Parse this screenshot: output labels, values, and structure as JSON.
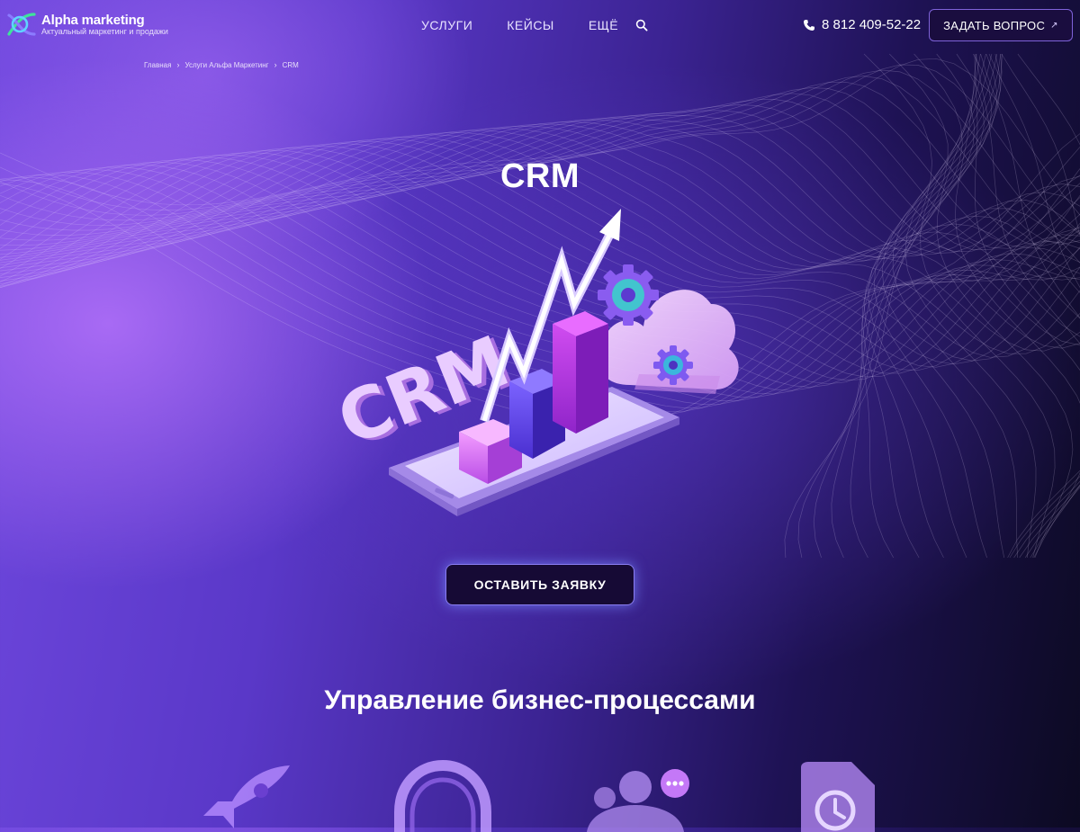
{
  "header": {
    "logo": {
      "name": "Alpha marketing",
      "tagline": "Актуальный маркетинг и продажи"
    },
    "nav": [
      {
        "label": "УСЛУГИ"
      },
      {
        "label": "КЕЙСЫ"
      },
      {
        "label": "ЕЩЁ"
      }
    ],
    "phone": "8 812 409-52-22",
    "ask_button": "ЗАДАТЬ ВОПРОС"
  },
  "breadcrumb": [
    {
      "label": "Главная"
    },
    {
      "label": "Услуги Альфа Маркетинг"
    },
    {
      "label": "CRM"
    }
  ],
  "hero": {
    "title": "CRM",
    "illustration_text": "CRM",
    "cta": "ОСТАВИТЬ ЗАЯВКУ"
  },
  "section": {
    "title": "Управление бизнес-процессами",
    "icons": [
      "rocket-icon",
      "headset-icon",
      "team-chat-icon",
      "document-history-icon"
    ]
  },
  "colors": {
    "accent_green": "#3fe39a",
    "button_dark": "#160a35",
    "purple_light": "#b78cff"
  }
}
